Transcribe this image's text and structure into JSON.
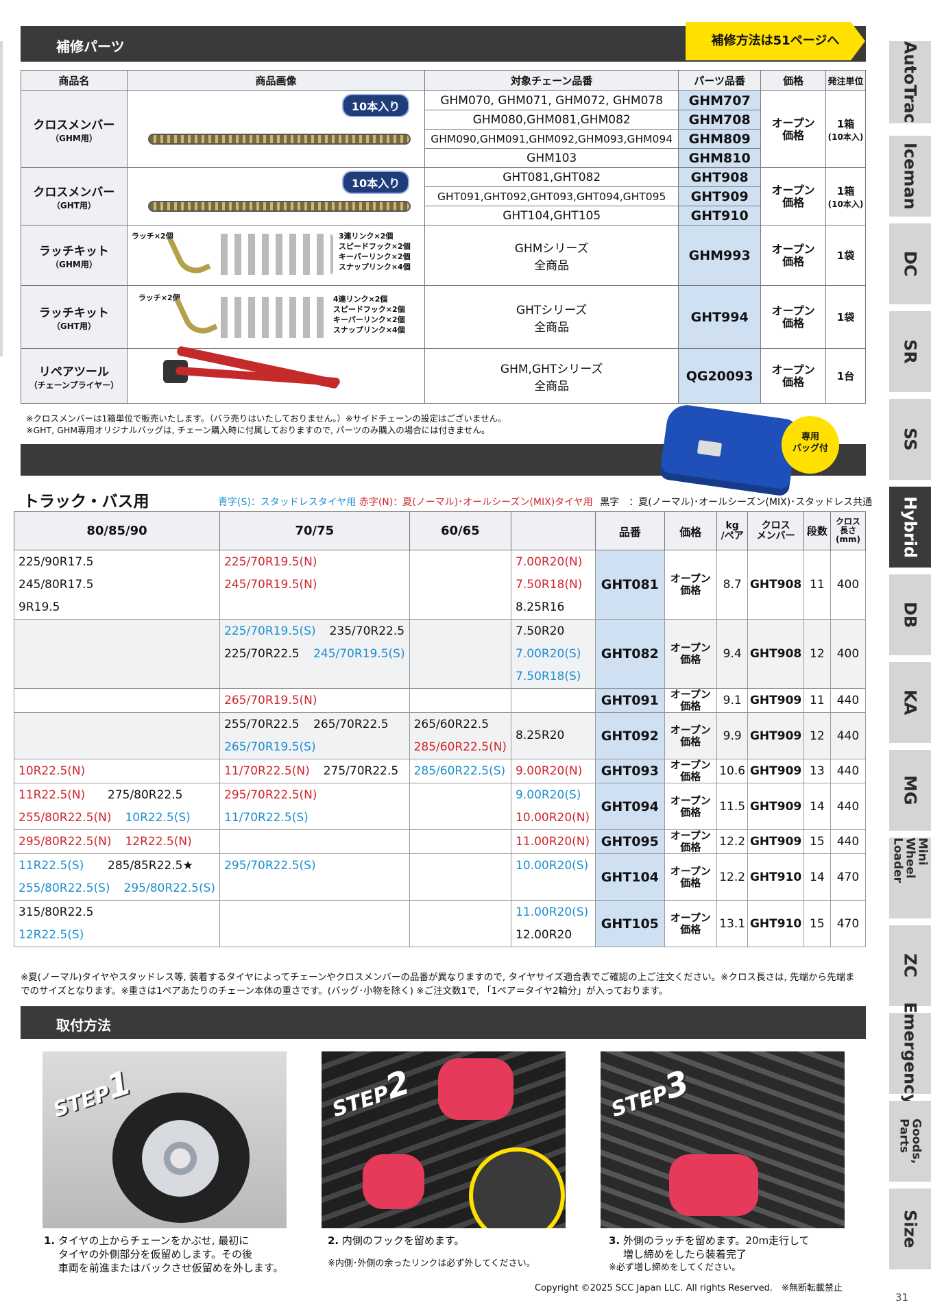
{
  "repair": {
    "title": "補修パーツ",
    "tag": "補修方法は51ページへ",
    "headers": [
      "商品名",
      "商品画像",
      "対象チェーン品番",
      "パーツ品番",
      "価格",
      "発注単位"
    ],
    "cross_ghm": {
      "name": "クロスメンバー",
      "sub": "（GHM用）",
      "badge": "10本入り",
      "targets": [
        "GHM070, GHM071, GHM072, GHM078",
        "GHM080,GHM081,GHM082",
        "GHM090,GHM091,GHM092,GHM093,GHM094",
        "GHM103"
      ],
      "parts": [
        "GHM707",
        "GHM708",
        "GHM809",
        "GHM810"
      ],
      "price": "オープン\n価格",
      "unit": "1箱",
      "unit_sub": "(10本入)"
    },
    "cross_ght": {
      "name": "クロスメンバー",
      "sub": "（GHT用）",
      "badge": "10本入り",
      "targets": [
        "GHT081,GHT082",
        "GHT091,GHT092,GHT093,GHT094,GHT095",
        "GHT104,GHT105"
      ],
      "parts": [
        "GHT908",
        "GHT909",
        "GHT910"
      ],
      "price": "オープン\n価格",
      "unit": "1箱",
      "unit_sub": "(10本入)"
    },
    "latch_ghm": {
      "name": "ラッチキット",
      "sub": "（GHM用）",
      "label1": "ラッチ×2個",
      "label2": "3連リンク×2個\nスピードフック×2個\nキーパーリンク×2個\nスナップリンク×4個",
      "target": "GHMシリーズ\n全商品",
      "part": "GHM993",
      "price": "オープン\n価格",
      "unit": "1袋"
    },
    "latch_ght": {
      "name": "ラッチキット",
      "sub": "（GHT用）",
      "label1": "ラッチ×2個",
      "label2": "4連リンク×2個\nスピードフック×2個\nキーパーリンク×2個\nスナップリンク×4個",
      "target": "GHTシリーズ\n全商品",
      "part": "GHT994",
      "price": "オープン\n価格",
      "unit": "1袋"
    },
    "repair_tool": {
      "name": "リペアツール",
      "sub": "（チェーンプライヤー）",
      "target": "GHM,GHTシリーズ\n全商品",
      "part": "QG20093",
      "price": "オープン\n価格",
      "unit": "1台"
    },
    "notes": [
      "※クロスメンバーは1箱単位で販売いたします。（バラ売りはいたしておりません。）※サイドチェーンの設定はございません。",
      "※GHT, GHM専用オリジナルバッグは, チェーン購入時に付属しておりますので, パーツのみ購入の場合には付きません。"
    ],
    "bag_badge": "専用\nバッグ付"
  },
  "truck": {
    "title": "トラック・バス用",
    "legend_blue": "青字(S)：スタッドレスタイヤ用",
    "legend_red": "赤字(N)：夏(ノーマル)･オールシーズン(MIX)タイヤ用",
    "legend_black": "黒字　：夏(ノーマル)･オールシーズン(MIX)･スタッドレス共通",
    "headers": [
      "80/85/90",
      "70/75",
      "60/65",
      "",
      "品番",
      "価格",
      "kg\n/ペア",
      "クロス\nメンバー",
      "段数",
      "クロス\n長さ\n(mm)"
    ],
    "rows": [
      {
        "c80": [
          [
            {
              "t": "225/90R17.5",
              "c": "k"
            }
          ],
          [
            {
              "t": "245/80R17.5",
              "c": "k"
            }
          ],
          [
            {
              "t": "9R19.5",
              "c": "k"
            }
          ]
        ],
        "c70": [
          [
            {
              "t": "225/70R19.5(N)",
              "c": "r"
            }
          ],
          [
            {
              "t": "245/70R19.5(N)",
              "c": "r"
            }
          ],
          []
        ],
        "c60": [],
        "c4": [
          [
            {
              "t": "7.00R20(N)",
              "c": "r"
            }
          ],
          [
            {
              "t": "7.50R18(N)",
              "c": "r"
            }
          ],
          [
            {
              "t": "8.25R16",
              "c": "k"
            }
          ]
        ],
        "code": "GHT081",
        "price": "オープン\n価格",
        "kg": "8.7",
        "cm": "GHT908",
        "steps": "11",
        "len": "400",
        "alt": false
      },
      {
        "c80": [],
        "c70": [
          [
            {
              "t": "225/70R19.5(S)",
              "c": "b"
            },
            {
              "t": "235/70R22.5",
              "c": "k"
            }
          ],
          [
            {
              "t": "225/70R22.5",
              "c": "k"
            },
            {
              "t": "245/70R19.5(S)",
              "c": "b"
            }
          ],
          []
        ],
        "c60": [],
        "c4": [
          [
            {
              "t": "7.50R20",
              "c": "k"
            }
          ],
          [
            {
              "t": "7.00R20(S)",
              "c": "b"
            }
          ],
          [
            {
              "t": "7.50R18(S)",
              "c": "b"
            }
          ]
        ],
        "code": "GHT082",
        "price": "オープン\n価格",
        "kg": "9.4",
        "cm": "GHT908",
        "steps": "12",
        "len": "400",
        "alt": true
      },
      {
        "c80": [],
        "c70": [
          [
            {
              "t": "265/70R19.5(N)",
              "c": "r"
            }
          ]
        ],
        "c60": [],
        "c4": [],
        "code": "GHT091",
        "price": "オープン\n価格",
        "kg": "9.1",
        "cm": "GHT909",
        "steps": "11",
        "len": "440",
        "alt": false
      },
      {
        "c80": [],
        "c70": [
          [
            {
              "t": "255/70R22.5",
              "c": "k"
            },
            {
              "t": "265/70R22.5",
              "c": "k"
            }
          ],
          [
            {
              "t": "265/70R19.5(S)",
              "c": "b"
            }
          ]
        ],
        "c60": [
          [
            {
              "t": "265/60R22.5",
              "c": "k"
            }
          ],
          [
            {
              "t": "285/60R22.5(N)",
              "c": "r"
            }
          ]
        ],
        "c4": [
          [
            {
              "t": "8.25R20",
              "c": "k"
            }
          ]
        ],
        "code": "GHT092",
        "price": "オープン\n価格",
        "kg": "9.9",
        "cm": "GHT909",
        "steps": "12",
        "len": "440",
        "alt": true
      },
      {
        "c80": [
          [
            {
              "t": "10R22.5(N)",
              "c": "r"
            }
          ]
        ],
        "c70": [
          [
            {
              "t": "11/70R22.5(N)",
              "c": "r"
            },
            {
              "t": "275/70R22.5",
              "c": "k"
            }
          ]
        ],
        "c60": [
          [
            {
              "t": "285/60R22.5(S)",
              "c": "b"
            }
          ]
        ],
        "c4": [
          [
            {
              "t": "9.00R20(N)",
              "c": "r"
            }
          ]
        ],
        "code": "GHT093",
        "price": "オープン\n価格",
        "kg": "10.6",
        "cm": "GHT909",
        "steps": "13",
        "len": "440",
        "alt": false
      },
      {
        "c80": [
          [
            {
              "t": "11R22.5(N)",
              "c": "r"
            },
            {
              "t": "275/80R22.5",
              "c": "k"
            }
          ],
          [
            {
              "t": "255/80R22.5(N)",
              "c": "r"
            },
            {
              "t": "10R22.5(S)",
              "c": "b"
            }
          ]
        ],
        "c70": [
          [
            {
              "t": "295/70R22.5(N)",
              "c": "r"
            }
          ],
          [
            {
              "t": "11/70R22.5(S)",
              "c": "b"
            }
          ]
        ],
        "c60": [],
        "c4": [
          [
            {
              "t": "9.00R20(S)",
              "c": "b"
            }
          ],
          [
            {
              "t": "10.00R20(N)",
              "c": "r"
            }
          ]
        ],
        "code": "GHT094",
        "price": "オープン\n価格",
        "kg": "11.5",
        "cm": "GHT909",
        "steps": "14",
        "len": "440",
        "alt": false
      },
      {
        "c80": [
          [
            {
              "t": "295/80R22.5(N)",
              "c": "r"
            },
            {
              "t": "12R22.5(N)",
              "c": "r"
            }
          ]
        ],
        "c70": [],
        "c60": [],
        "c4": [
          [
            {
              "t": "11.00R20(N)",
              "c": "r"
            }
          ]
        ],
        "code": "GHT095",
        "price": "オープン\n価格",
        "kg": "12.2",
        "cm": "GHT909",
        "steps": "15",
        "len": "440",
        "alt": false
      },
      {
        "c80": [
          [
            {
              "t": "11R22.5(S)",
              "c": "b"
            },
            {
              "t": "285/85R22.5★",
              "c": "k"
            }
          ],
          [
            {
              "t": "255/80R22.5(S)",
              "c": "b"
            },
            {
              "t": "295/80R22.5(S)",
              "c": "b"
            }
          ]
        ],
        "c70": [
          [
            {
              "t": "295/70R22.5(S)",
              "c": "b"
            }
          ],
          []
        ],
        "c60": [],
        "c4": [
          [
            {
              "t": "10.00R20(S)",
              "c": "b"
            }
          ],
          []
        ],
        "code": "GHT104",
        "price": "オープン\n価格",
        "kg": "12.2",
        "cm": "GHT910",
        "steps": "14",
        "len": "470",
        "alt": false
      },
      {
        "c80": [
          [
            {
              "t": "315/80R22.5",
              "c": "k"
            }
          ],
          [
            {
              "t": "12R22.5(S)",
              "c": "b"
            }
          ]
        ],
        "c70": [],
        "c60": [],
        "c4": [
          [
            {
              "t": "11.00R20(S)",
              "c": "b"
            }
          ],
          [
            {
              "t": "12.00R20",
              "c": "k"
            }
          ]
        ],
        "code": "GHT105",
        "price": "オープン\n価格",
        "kg": "13.1",
        "cm": "GHT910",
        "steps": "15",
        "len": "470",
        "alt": false
      }
    ],
    "notes": "※夏(ノーマル)タイヤやスタッドレス等, 装着するタイヤによってチェーンやクロスメンバーの品番が異なりますので, タイヤサイズ適合表でご確認の上ご注文ください。※クロス長さは, 先端から先端までのサイズとなります。※重さは1ペアあたりのチェーン本体の重さです。(バッグ･小物を除く) ※ご注文数1で, 「1ペア＝タイヤ2輪分」が入っております。"
  },
  "mount": {
    "title": "取付方法",
    "steps": [
      {
        "label": "STEP",
        "num": "1",
        "n": "1.",
        "text": "タイヤの上からチェーンをかぶせ, 最初に\nタイヤの外側部分を仮留めします。その後\n車両を前進またはバックさせ仮留めを外します。",
        "sub": ""
      },
      {
        "label": "STEP",
        "num": "2",
        "n": "2.",
        "text": "内側のフックを留めます。",
        "sub": "※内側･外側の余ったリンクは必ず外してください。"
      },
      {
        "label": "STEP",
        "num": "3",
        "n": "3.",
        "text": "外側のラッチを留めます。20m走行して\n増し締めをしたら装着完了",
        "sub": "※必ず増し締めをしてください。"
      }
    ]
  },
  "footer": {
    "copyright": "Copyright ©2025 SCC Japan LLC. All rights Reserved.　※無断転載禁止",
    "page": "31"
  },
  "tabs": [
    "AutoTrac",
    "Iceman",
    "DC",
    "SR",
    "SS",
    "Hybrid",
    "DB",
    "KA",
    "MG",
    "Mini\nWheel Loader",
    "ZC",
    "Emergency",
    "Goods,\nParts",
    "Size"
  ],
  "active_tab": "Hybrid"
}
